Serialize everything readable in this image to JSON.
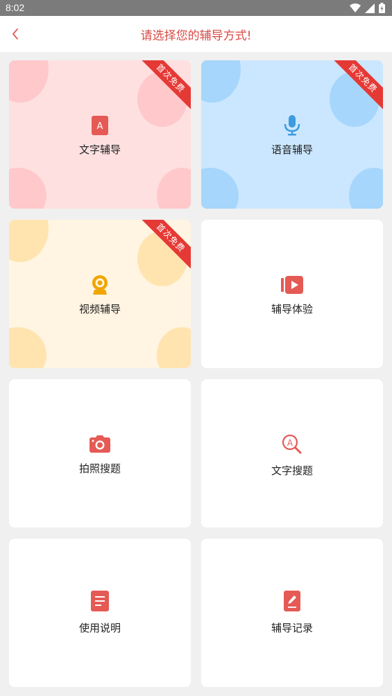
{
  "status_bar": {
    "time": "8:02"
  },
  "header": {
    "title": "请选择您的辅导方式!"
  },
  "cards": [
    {
      "label": "文字辅导",
      "icon": "text-a-icon",
      "badge": "首次免费",
      "theme": "pink"
    },
    {
      "label": "语音辅导",
      "icon": "microphone-icon",
      "badge": "首次免费",
      "theme": "blue"
    },
    {
      "label": "视频辅导",
      "icon": "webcam-icon",
      "badge": "首次免费",
      "theme": "cream"
    },
    {
      "label": "辅导体验",
      "icon": "video-play-icon",
      "badge": "",
      "theme": "white"
    },
    {
      "label": "拍照搜题",
      "icon": "camera-icon",
      "badge": "",
      "theme": "white"
    },
    {
      "label": "文字搜题",
      "icon": "text-search-icon",
      "badge": "",
      "theme": "white"
    },
    {
      "label": "使用说明",
      "icon": "document-icon",
      "badge": "",
      "theme": "white"
    },
    {
      "label": "辅导记录",
      "icon": "edit-record-icon",
      "badge": "",
      "theme": "white"
    }
  ],
  "colors": {
    "accent": "#e55a55",
    "title": "#d94a45",
    "ribbon": "#e53935",
    "pink_bg": "#ffe0e0",
    "blue_bg": "#cbe7ff",
    "cream_bg": "#fff5e2",
    "mic": "#3d9be0",
    "webcam": "#f0a500"
  }
}
